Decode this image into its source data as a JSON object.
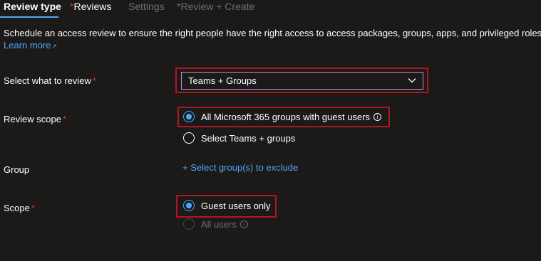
{
  "tabs": [
    {
      "label": "Review type",
      "required": false,
      "state": "active"
    },
    {
      "label": "Reviews",
      "required": true,
      "state": "normal"
    },
    {
      "label": "Settings",
      "required": false,
      "state": "disabled"
    },
    {
      "label": "Review + Create",
      "required": true,
      "state": "disabled"
    }
  ],
  "required_marker": "*",
  "description": "Schedule an access review to ensure the right people have the right access to access packages, groups, apps, and privileged roles.",
  "learn_more": "Learn more",
  "form": {
    "select_what_label": "Select what to review",
    "select_what_value": "Teams + Groups",
    "review_scope_label": "Review scope",
    "review_scope_options": [
      {
        "label": "All Microsoft 365 groups with guest users",
        "selected": true,
        "info": true
      },
      {
        "label": "Select Teams + groups",
        "selected": false,
        "info": false
      }
    ],
    "group_label": "Group",
    "group_link": "+ Select group(s) to exclude",
    "scope_label": "Scope",
    "scope_options": [
      {
        "label": "Guest users only",
        "selected": true,
        "disabled": false
      },
      {
        "label": "All users",
        "selected": false,
        "disabled": true,
        "info": true
      }
    ]
  },
  "colors": {
    "background": "#1b1a19",
    "accent": "#4ea7f8",
    "required": "#d13438",
    "highlight_box": "#b2161f",
    "disabled_text": "#6e6e6e"
  }
}
